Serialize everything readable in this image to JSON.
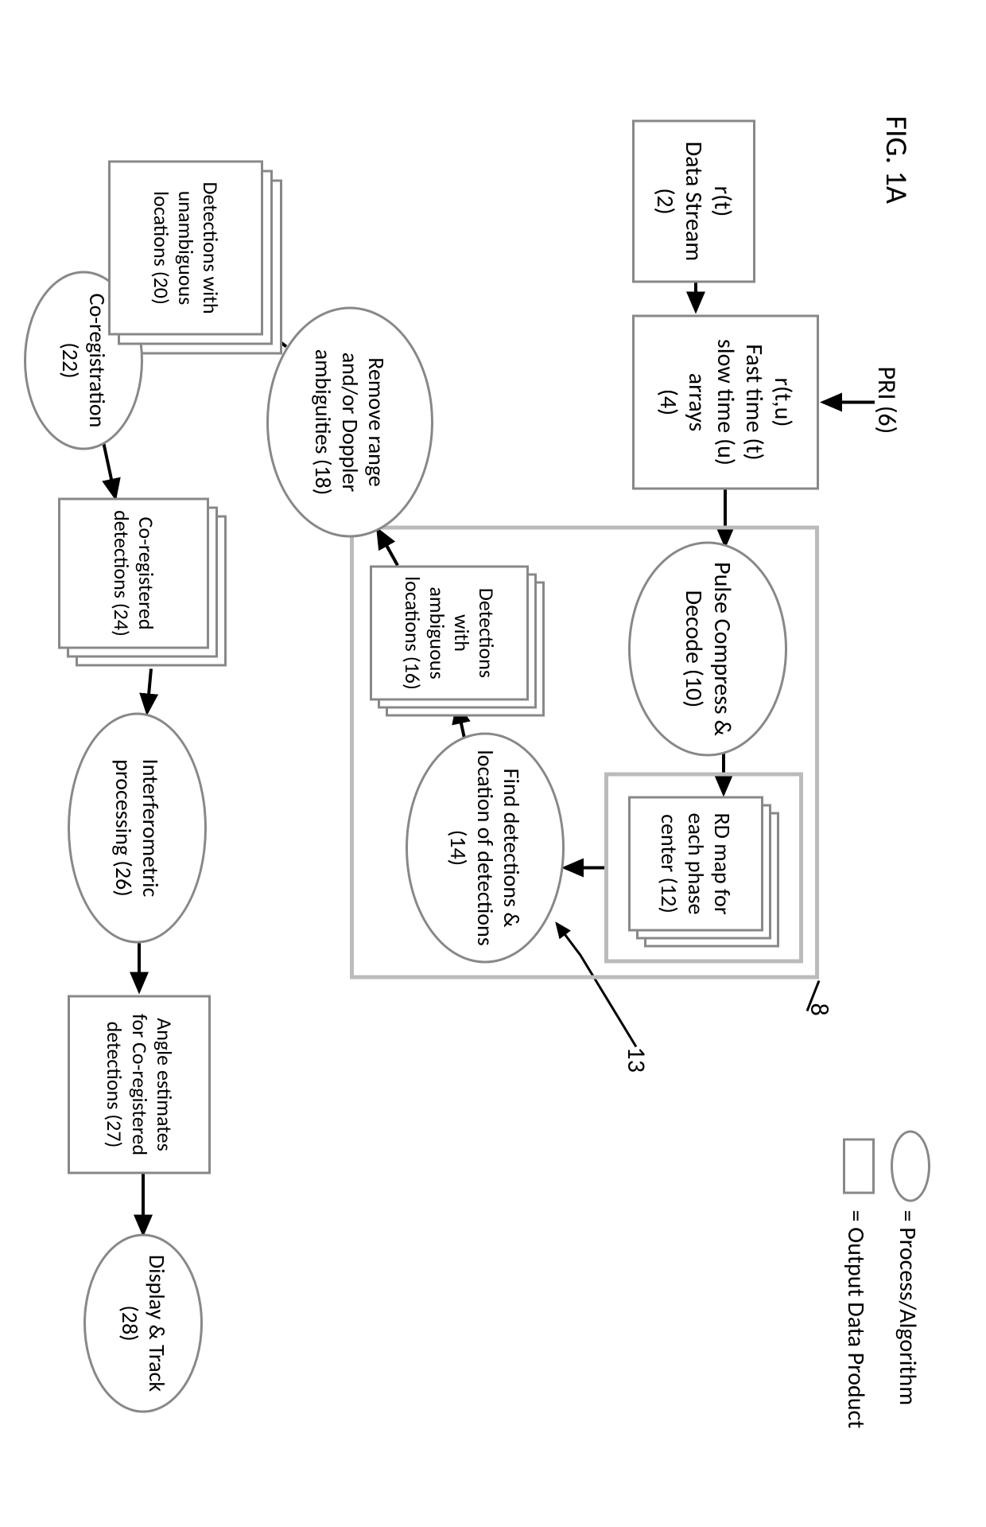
{
  "figure_label": "FIG. 1A",
  "legend": {
    "process": "= Process/Algorithm",
    "output": "= Output Data Product"
  },
  "callouts": {
    "pri": "PRI (6)",
    "eight": "8",
    "thirteen": "13"
  },
  "nodes": {
    "n2": "r(t)\nData Stream\n(2)",
    "n4": "r(t,u)\nFast time (t)\nslow time (u)\narrays\n(4)",
    "n10": "Pulse Compress & Decode (10)",
    "n12": "RD map for each phase center (12)",
    "n14": "Find detections & location of detections (14)",
    "n16": "Detections with ambiguous locations (16)",
    "n18": "Remove range and/or Doppler ambiguities (18)",
    "n20": "Detections with unambiguous locations (20)",
    "n22": "Co-registration (22)",
    "n24": "Co-registered detections (24)",
    "n26": "Interferometric processing (26)",
    "n27": "Angle estimates for Co-registered detections (27)",
    "n28": "Display & Track (28)"
  }
}
